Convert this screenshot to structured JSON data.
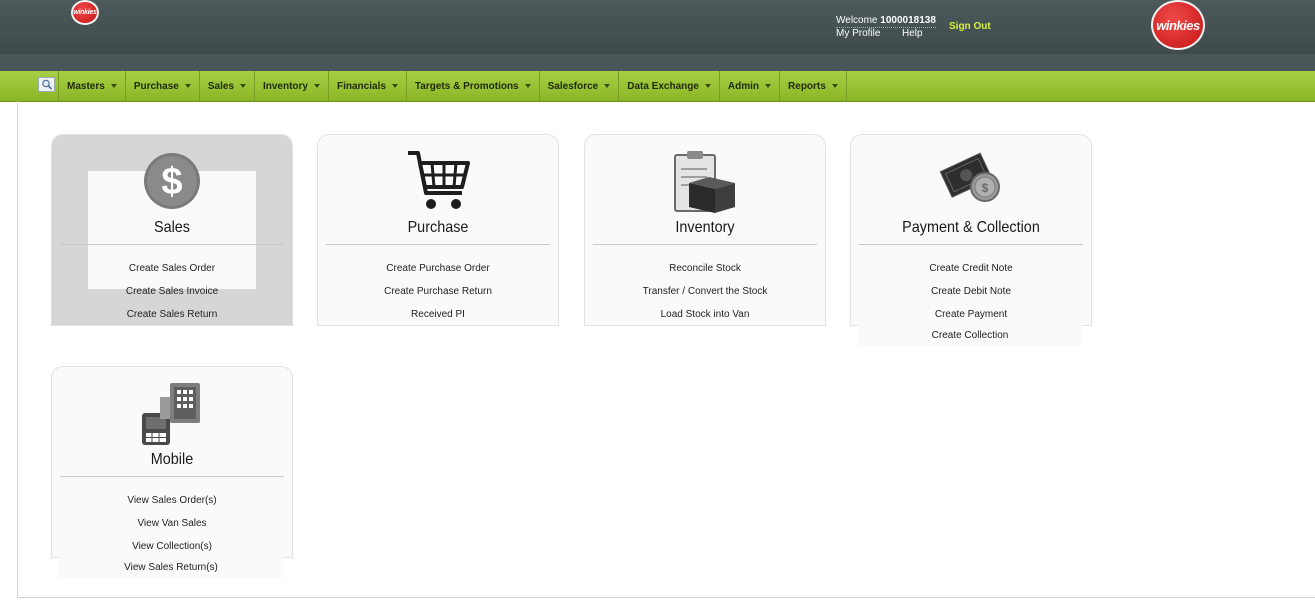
{
  "header": {
    "logo_small": "winkies",
    "logo_big": "winkies",
    "welcome_label": "Welcome",
    "user_id": "1000018138",
    "my_profile": "My Profile",
    "help": "Help",
    "sign_out": "Sign Out"
  },
  "nav": {
    "search_icon": "search-icon",
    "items": [
      "Masters",
      "Purchase",
      "Sales",
      "Inventory",
      "Financials",
      "Targets & Promotions",
      "Salesforce",
      "Data Exchange",
      "Admin",
      "Reports"
    ]
  },
  "cards": {
    "sales": {
      "title": "Sales",
      "icon": "dollar-icon",
      "links": [
        "Create Sales Order",
        "Create Sales Invoice",
        "Create Sales Return"
      ]
    },
    "purchase": {
      "title": "Purchase",
      "icon": "shopping-cart-icon",
      "links": [
        "Create Purchase Order",
        "Create Purchase Return",
        "Received PI"
      ]
    },
    "inventory": {
      "title": "Inventory",
      "icon": "clipboard-box-icon",
      "links": [
        "Reconcile Stock",
        "Transfer / Convert the Stock",
        "Load Stock into Van"
      ]
    },
    "payment": {
      "title": "Payment & Collection",
      "icon": "money-coins-icon",
      "links": [
        "Create Credit Note",
        "Create Debit Note",
        "Create Payment",
        "Create Collection"
      ]
    },
    "mobile": {
      "title": "Mobile",
      "icon": "mobile-building-icon",
      "links": [
        "View Sales Order(s)",
        "View Van Sales",
        "View Collection(s)",
        "View Sales Return(s)"
      ]
    }
  }
}
